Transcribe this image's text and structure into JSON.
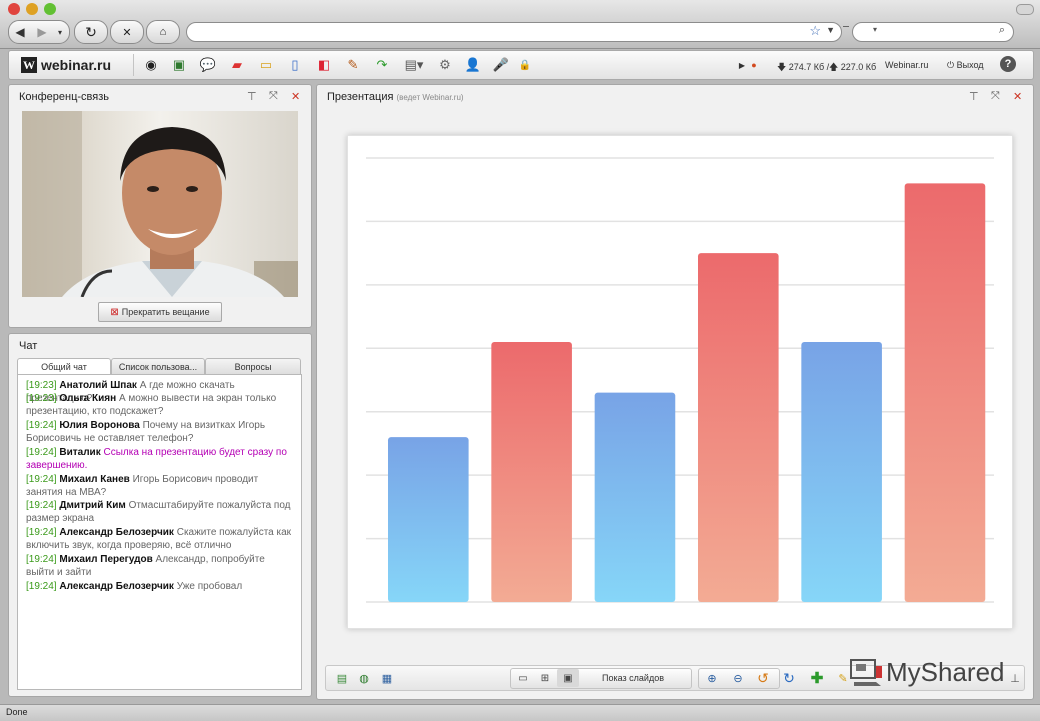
{
  "browser": {
    "status_text": "Done"
  },
  "app": {
    "logo_text": "webinar.ru",
    "logo_mark": "W",
    "download_text": "274.7 Кб /",
    "upload_text": "227.0 Кб",
    "site_link": "Webinar.ru",
    "logout_label": "Выход",
    "help_label": "?"
  },
  "conference": {
    "title": "Конференц-связь",
    "stop_button": "Прекратить вещание"
  },
  "chat": {
    "title": "Чат",
    "tabs": [
      "Общий чат",
      "Список пользова...",
      "Вопросы"
    ],
    "messages": [
      {
        "time": "[19:23]",
        "name": "Анатолий Шпак",
        "text": "А где можно скачать презентацию?"
      },
      {
        "time": "[19:23]",
        "name": "Ольга Киян",
        "text": "А можно вывести на экран только презентацию, кто подскажет?"
      },
      {
        "time": "[19:24]",
        "name": "Юлия Воронова",
        "text": "Почему на визитках Игорь Борисовичь не оставляет телефон?"
      },
      {
        "time": "[19:24]",
        "name": "Виталик",
        "text": "Ссылка на презентацию будет сразу по завершению."
      },
      {
        "time": "[19:24]",
        "name": "Михаил Канев",
        "text": "Игорь Борисович проводит занятия на МВА?"
      },
      {
        "time": "[19:24]",
        "name": "Дмитрий Ким",
        "text": "Отмасштабируйте пожалуйста под размер экрана"
      },
      {
        "time": "[19:24]",
        "name": "Александр Белозерчик",
        "text": "Скажите пожалуйста как включить звук, когда проверяю, всё отлично"
      },
      {
        "time": "[19:24]",
        "name": "Михаил Перегудов",
        "text": "Александр, попробуйте выйти и зайти"
      },
      {
        "time": "[19:24]",
        "name": "Александр Белозерчик",
        "text": "Уже пробовал"
      }
    ]
  },
  "presentation": {
    "title": "Презентация",
    "subtitle": "(ведет Webinar.ru)",
    "slideshow_label": "Показ слайдов"
  },
  "watermark": {
    "text": "MyShared"
  },
  "chart_data": {
    "type": "bar",
    "categories": [
      "",
      "",
      "",
      "",
      "",
      ""
    ],
    "values": [
      26,
      41,
      33,
      55,
      41,
      66
    ],
    "colors": [
      "#7fb0ec",
      "#ef8b82",
      "#7fb0ec",
      "#ef8b82",
      "#7fb0ec",
      "#ef8b82"
    ],
    "ylim": [
      0,
      70
    ],
    "grid": true,
    "title": "",
    "xlabel": "",
    "ylabel": ""
  }
}
